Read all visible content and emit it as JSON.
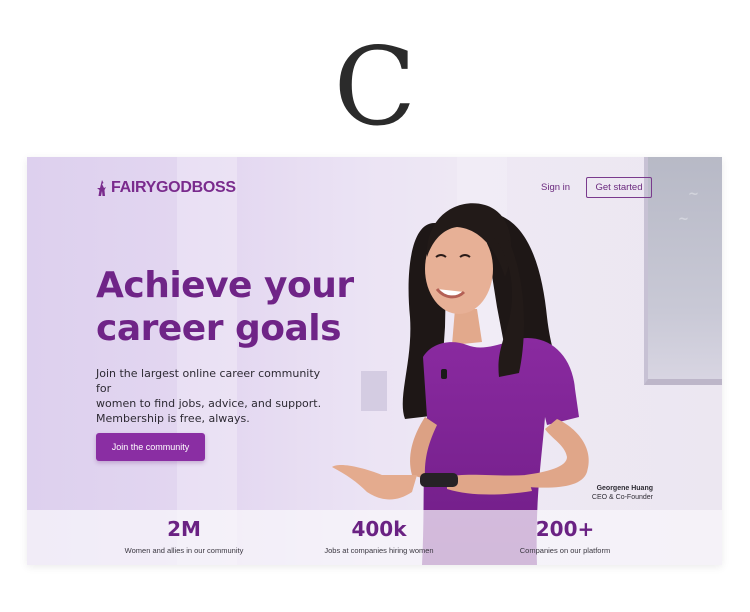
{
  "decor": {
    "letter": "C"
  },
  "header": {
    "logo_text": "FAIRYGODBOSS",
    "signin_label": "Sign in",
    "get_started_label": "Get started"
  },
  "hero": {
    "headline_line1": "Achieve your",
    "headline_line2": "career goals",
    "subtext_line1": "Join the largest online career community for",
    "subtext_line2": "women to find jobs, advice, and support.",
    "subtext_line3": "Membership is free, always.",
    "cta_label": "Join the community"
  },
  "caption": {
    "name": "Georgene Huang",
    "title": "CEO & Co-Founder"
  },
  "stats": [
    {
      "value": "2M",
      "label": "Women and allies in our community"
    },
    {
      "value": "400k",
      "label": "Jobs at companies hiring women"
    },
    {
      "value": "200+",
      "label": "Companies on our platform"
    }
  ],
  "colors": {
    "brand_purple": "#6f2487",
    "cta_purple": "#8a2ea3",
    "hero_background": "#e4d8f1"
  }
}
